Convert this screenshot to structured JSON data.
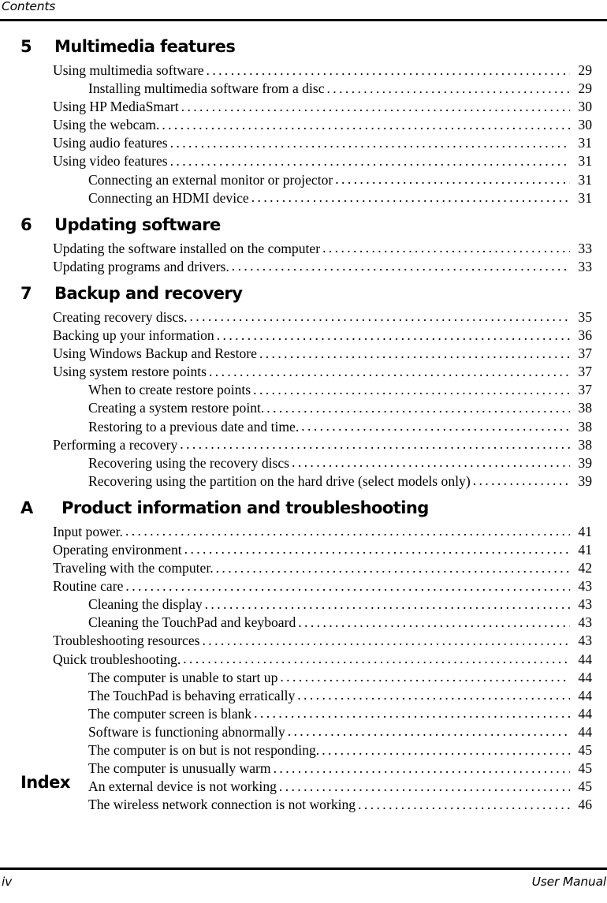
{
  "header": {
    "label": "Contents"
  },
  "footer": {
    "page_number": "iv",
    "document_title": "User Manual"
  },
  "index_heading": "Index",
  "toc": {
    "chapters": [
      {
        "number": "5",
        "title": "Multimedia features",
        "entries": [
          {
            "level": 1,
            "title": "Using multimedia software",
            "page": "29"
          },
          {
            "level": 2,
            "title": "Installing multimedia software from a disc",
            "page": "29"
          },
          {
            "level": 1,
            "title": "Using HP MediaSmart",
            "page": "30"
          },
          {
            "level": 1,
            "title": "Using the webcam.",
            "page": "30"
          },
          {
            "level": 1,
            "title": "Using audio features",
            "page": "31"
          },
          {
            "level": 1,
            "title": "Using video features",
            "page": "31"
          },
          {
            "level": 2,
            "title": "Connecting an external monitor or projector",
            "page": "31"
          },
          {
            "level": 2,
            "title": "Connecting an HDMI device",
            "page": "31"
          }
        ]
      },
      {
        "number": "6",
        "title": "Updating software",
        "entries": [
          {
            "level": 1,
            "title": "Updating the software installed on the computer",
            "page": "33"
          },
          {
            "level": 1,
            "title": "Updating programs and drivers.",
            "page": "33"
          }
        ]
      },
      {
        "number": "7",
        "title": "Backup and recovery",
        "entries": [
          {
            "level": 1,
            "title": "Creating recovery discs.",
            "page": "35"
          },
          {
            "level": 1,
            "title": "Backing up your information",
            "page": "36"
          },
          {
            "level": 1,
            "title": "Using Windows Backup and Restore",
            "page": "37"
          },
          {
            "level": 1,
            "title": "Using system restore points",
            "page": "37"
          },
          {
            "level": 2,
            "title": "When to create restore points",
            "page": "37"
          },
          {
            "level": 2,
            "title": "Creating a system restore point.",
            "page": "38"
          },
          {
            "level": 2,
            "title": "Restoring to a previous date and time.",
            "page": "38"
          },
          {
            "level": 1,
            "title": "Performing a recovery",
            "page": "38"
          },
          {
            "level": 2,
            "title": "Recovering using the recovery discs",
            "page": "39"
          },
          {
            "level": 2,
            "title": "Recovering using the partition on the hard drive (select models only)",
            "page": "39"
          }
        ]
      },
      {
        "number": "A",
        "title": "Product information and troubleshooting",
        "appendix": true,
        "entries": [
          {
            "level": 1,
            "title": "Input power.",
            "page": "41"
          },
          {
            "level": 1,
            "title": "Operating environment",
            "page": "41"
          },
          {
            "level": 1,
            "title": "Traveling with the computer.",
            "page": "42"
          },
          {
            "level": 1,
            "title": "Routine care",
            "page": "43"
          },
          {
            "level": 2,
            "title": "Cleaning the display",
            "page": "43"
          },
          {
            "level": 2,
            "title": "Cleaning the TouchPad and keyboard",
            "page": "43"
          },
          {
            "level": 1,
            "title": "Troubleshooting resources",
            "page": "43"
          },
          {
            "level": 1,
            "title": "Quick troubleshooting.",
            "page": "44"
          },
          {
            "level": 2,
            "title": "The computer is unable to start up",
            "page": "44"
          },
          {
            "level": 2,
            "title": "The TouchPad is behaving erratically",
            "page": "44"
          },
          {
            "level": 2,
            "title": "The computer screen is blank",
            "page": "44"
          },
          {
            "level": 2,
            "title": "Software is functioning abnormally",
            "page": "44"
          },
          {
            "level": 2,
            "title": "The computer is on but is not responding.",
            "page": "45"
          },
          {
            "level": 2,
            "title": "The computer is unusually warm",
            "page": "45"
          },
          {
            "level": 2,
            "title": "An external device is not working",
            "page": "45"
          },
          {
            "level": 2,
            "title": "The wireless network connection is not working",
            "page": "46"
          }
        ]
      }
    ]
  }
}
